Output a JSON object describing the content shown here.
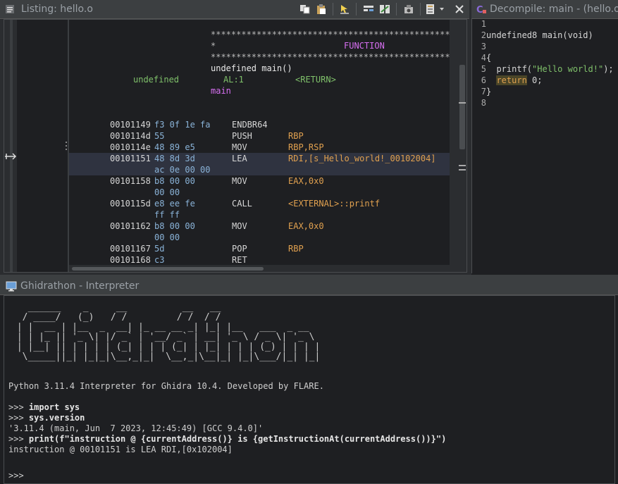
{
  "listing": {
    "title": "Listing:  hello.o",
    "header": {
      "stars": "************************************************",
      "star_prefix": "*",
      "function_word": "FUNCTION",
      "signature_type": "undefined ",
      "signature_name": "main",
      "signature_args": "()",
      "ret_type": "undefined",
      "ret_reg": "AL:1",
      "ret_name": "<RETURN>",
      "label": "main"
    },
    "instructions": [
      {
        "addr": "00101149",
        "bytes": "f3 0f 1e fa",
        "bytes2": "",
        "mnemonic": "ENDBR64",
        "operands": "",
        "operands2": ""
      },
      {
        "addr": "0010114d",
        "bytes": "55",
        "bytes2": "",
        "mnemonic": "PUSH",
        "operands": "RBP",
        "operands2": ""
      },
      {
        "addr": "0010114e",
        "bytes": "48 89 e5",
        "bytes2": "",
        "mnemonic": "MOV",
        "operands": "RBP,RSP",
        "operands2": ""
      },
      {
        "addr": "00101151",
        "bytes": "48 8d 3d",
        "bytes2": "ac 0e 00 00",
        "mnemonic": "LEA",
        "operands": "RDI,[s_Hello_world!_00102004]",
        "operands2": ""
      },
      {
        "addr": "00101158",
        "bytes": "b8 00 00",
        "bytes2": "00 00",
        "mnemonic": "MOV",
        "operands": "EAX,0x0",
        "operands2": ""
      },
      {
        "addr": "0010115d",
        "bytes": "e8 ee fe",
        "bytes2": "ff ff",
        "mnemonic": "CALL",
        "operands": "<EXTERNAL>::printf",
        "operands2": ""
      },
      {
        "addr": "00101162",
        "bytes": "b8 00 00",
        "bytes2": "00 00",
        "mnemonic": "MOV",
        "operands": "EAX,0x0",
        "operands2": ""
      },
      {
        "addr": "00101167",
        "bytes": "5d",
        "bytes2": "",
        "mnemonic": "POP",
        "operands": "RBP",
        "operands2": ""
      },
      {
        "addr": "00101168",
        "bytes": "c3",
        "bytes2": "",
        "mnemonic": "RET",
        "operands": "",
        "operands2": ""
      }
    ]
  },
  "decompile": {
    "title": "Decompile: main -  (hello.o)",
    "line_numbers": [
      "1",
      "2",
      "3",
      "4",
      "5",
      "6",
      "7",
      "8"
    ],
    "lines": {
      "l2": "undefined8 main(void)",
      "l4": "{",
      "l5a": "  printf(",
      "l5b": "\"Hello world!\"",
      "l5c": ");",
      "l6a": "  ",
      "l6b": "return",
      "l6c": " 0;",
      "l7": "}"
    }
  },
  "interpreter": {
    "title": "Ghidrathon - Interpreter",
    "banner_art": "   ______    _     __          __   __\n  / ____/   (_)   / /         / /  / /\n | |  __ | |__  _  __| |_ __ __ _| |_| |__   ___  _ __\n | | |_ || '_ \\| |/ _` | '__/ _` | __| '_ \\ / _ \\| '_ \\\n | |__| || | | | | (_| | | | (_| | |_| | | | (_) | | | |\n  \\_____||_| |_|_|\\__,_|_|  \\__,_|\\__|_| |_|\\___/|_| |_|",
    "banner_line": "Python 3.11.4 Interpreter for Ghidra 10.4. Developed by FLARE.",
    "prompt": ">>> ",
    "cmd1": "import sys",
    "cmd2": "sys.version",
    "out2": "'3.11.4 (main, Jun  7 2023, 12:45:49) [GCC 9.4.0]'",
    "cmd3": "print(f\"instruction @ {currentAddress()} is {getInstructionAt(currentAddress())}\")",
    "out3": "instruction @ 00101151 is LEA RDI,[0x102004]",
    "final_prompt": ">>>"
  },
  "colors": {
    "background": "#1e1f22",
    "titlebar": "#3c3f41",
    "highlight": "#2f3340"
  }
}
